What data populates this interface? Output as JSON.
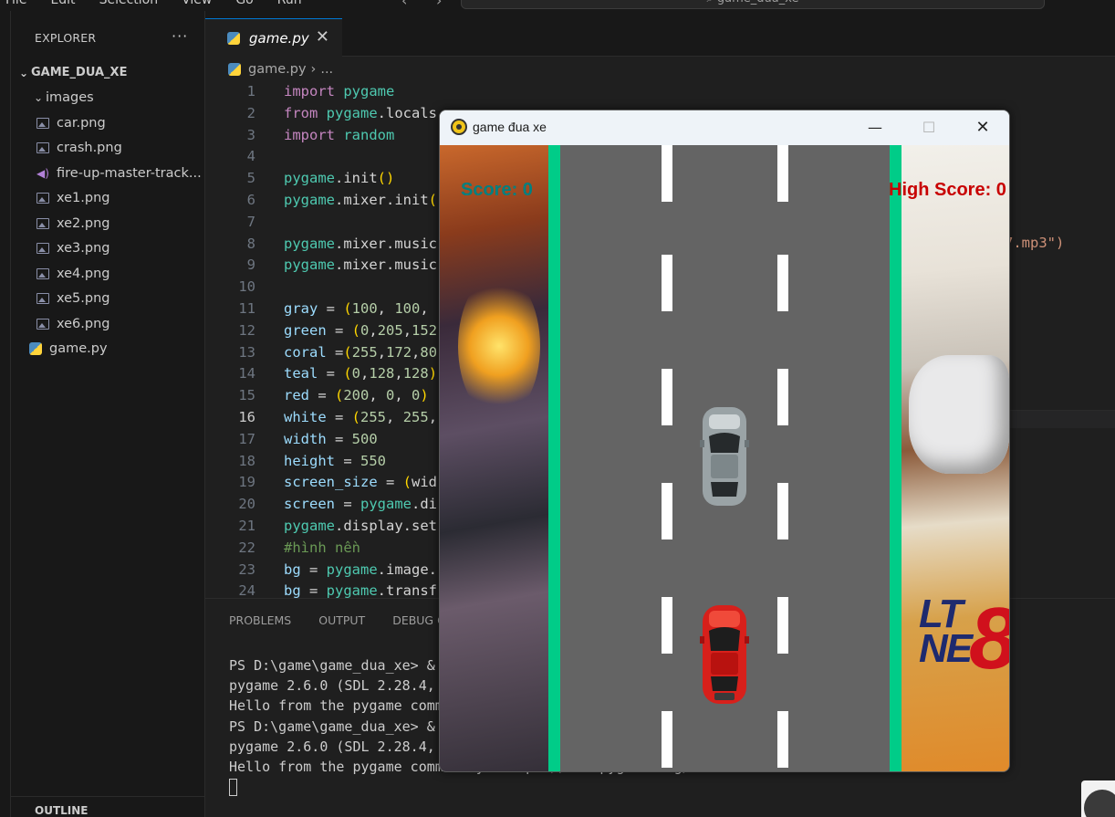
{
  "menu": [
    "File",
    "Edit",
    "Selection",
    "View",
    "Go",
    "Run"
  ],
  "command_center": "game_dua_xe",
  "explorer": {
    "title": "EXPLORER",
    "more": "···",
    "root": "GAME_DUA_XE",
    "folder": "images",
    "files": [
      "car.png",
      "crash.png",
      "fire-up-master-track...",
      "xe1.png",
      "xe2.png",
      "xe3.png",
      "xe4.png",
      "xe5.png",
      "xe6.png"
    ],
    "root_file": "game.py",
    "outline": "OUTLINE"
  },
  "editor": {
    "tab": "game.py",
    "breadcrumb": [
      "game.py",
      "..."
    ],
    "current_line": 16,
    "lines": [
      "import pygame",
      "from pygame.locals",
      "import random",
      "",
      "pygame.init()",
      "pygame.mixer.init(",
      "",
      "pygame.mixer.music",
      "pygame.mixer.music",
      "",
      "gray = (100, 100,",
      "green = (0,205,152",
      "coral =(255,172,80",
      "teal = (0,128,128)",
      "red = (200, 0, 0)",
      "white = (255, 255,",
      "width = 500",
      "height = 550",
      "screen_size = (wid",
      "screen = pygame.di",
      "pygame.display.set",
      "#hình nền",
      "bg = pygame.image.",
      "bg = pygame.transf"
    ],
    "line8_tail": "7.mp3\")"
  },
  "panel": {
    "tabs": [
      "PROBLEMS",
      "OUTPUT",
      "DEBUG C"
    ],
    "terminal": [
      "PS D:\\game\\game_dua_xe> &",
      "pygame 2.6.0 (SDL 2.28.4,",
      "Hello from the pygame comm",
      "PS D:\\game\\game_dua_xe> &",
      "pygame 2.6.0 (SDL 2.28.4,",
      "Hello from the pygame community. https://www.pygame.org/contribute.html"
    ]
  },
  "game_window": {
    "title": "game đua xe",
    "score": "Score: 0",
    "high_score": "High Score: 0",
    "logo_text": [
      "LT",
      "NE"
    ],
    "logo_number": "8",
    "colors": {
      "road": "#646464",
      "edge": "#00cc88",
      "score": "#008080",
      "high_score": "#c80000",
      "lane_marker": "#ffffff"
    }
  },
  "icons": {
    "minimize": "—",
    "maximize": "☐",
    "close": "✕",
    "chevron": "›",
    "tab_close": "✕"
  }
}
